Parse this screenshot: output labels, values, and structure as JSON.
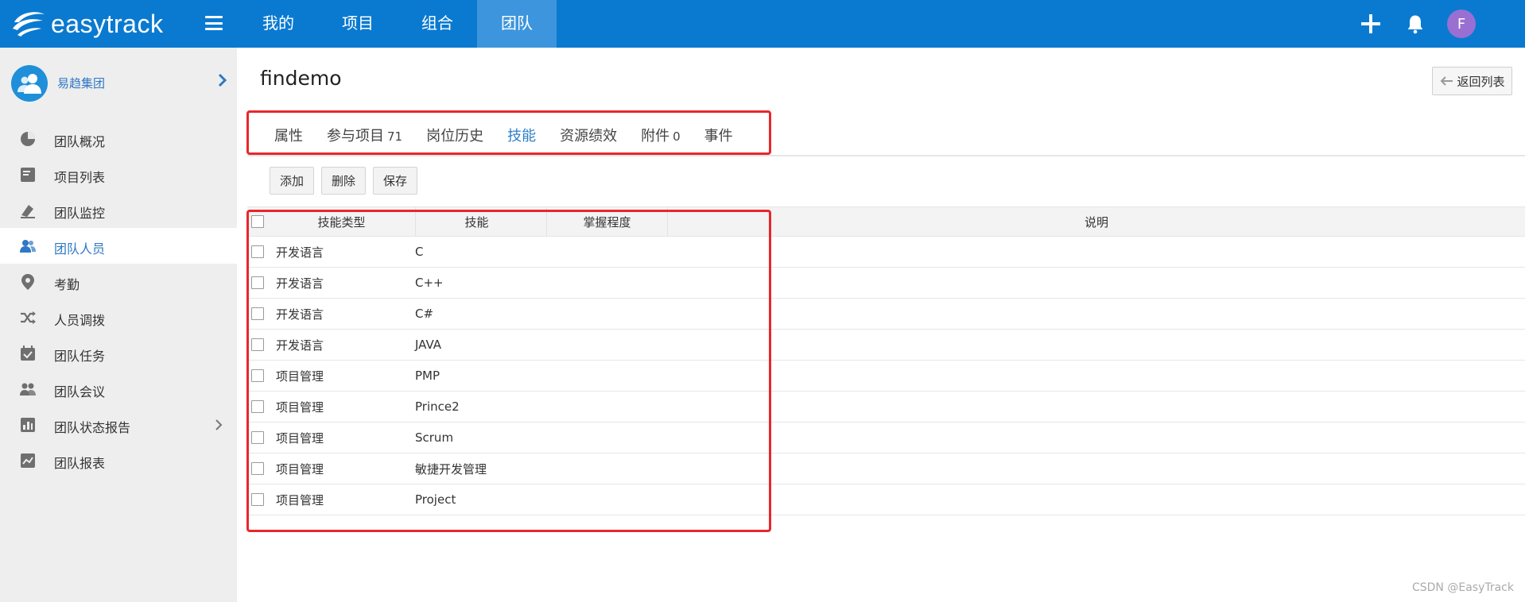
{
  "brand": {
    "name": "easytrack"
  },
  "topnav": {
    "items": [
      {
        "label": "我的",
        "active": false
      },
      {
        "label": "项目",
        "active": false
      },
      {
        "label": "组合",
        "active": false
      },
      {
        "label": "团队",
        "active": true
      }
    ],
    "user_initial": "F"
  },
  "sidebar": {
    "team_name": "易趋集团",
    "items": [
      {
        "label": "团队概况",
        "icon": "pie-chart-icon"
      },
      {
        "label": "项目列表",
        "icon": "inbox-icon"
      },
      {
        "label": "团队监控",
        "icon": "monitor-icon"
      },
      {
        "label": "团队人员",
        "icon": "people-icon",
        "active": true
      },
      {
        "label": "考勤",
        "icon": "location-icon"
      },
      {
        "label": "人员调拨",
        "icon": "shuffle-icon"
      },
      {
        "label": "团队任务",
        "icon": "calendar-check-icon"
      },
      {
        "label": "团队会议",
        "icon": "meeting-icon"
      },
      {
        "label": "团队状态报告",
        "icon": "bar-report-icon",
        "has_submenu": true
      },
      {
        "label": "团队报表",
        "icon": "chart-report-icon"
      }
    ]
  },
  "page": {
    "title": "findemo",
    "back_label": "返回列表"
  },
  "tabs": [
    {
      "label": "属性",
      "count": ""
    },
    {
      "label": "参与项目",
      "count": "71"
    },
    {
      "label": "岗位历史",
      "count": ""
    },
    {
      "label": "技能",
      "count": "",
      "active": true
    },
    {
      "label": "资源绩效",
      "count": ""
    },
    {
      "label": "附件",
      "count": "0"
    },
    {
      "label": "事件",
      "count": ""
    }
  ],
  "toolbar": {
    "add_label": "添加",
    "delete_label": "删除",
    "save_label": "保存"
  },
  "grid": {
    "columns": {
      "type": "技能类型",
      "skill": "技能",
      "level": "掌握程度",
      "desc": "说明"
    },
    "rows": [
      {
        "type": "开发语言",
        "skill": "C",
        "level": "",
        "desc": ""
      },
      {
        "type": "开发语言",
        "skill": "C++",
        "level": "",
        "desc": ""
      },
      {
        "type": "开发语言",
        "skill": "C#",
        "level": "",
        "desc": ""
      },
      {
        "type": "开发语言",
        "skill": "JAVA",
        "level": "",
        "desc": ""
      },
      {
        "type": "项目管理",
        "skill": "PMP",
        "level": "",
        "desc": ""
      },
      {
        "type": "项目管理",
        "skill": "Prince2",
        "level": "",
        "desc": ""
      },
      {
        "type": "项目管理",
        "skill": "Scrum",
        "level": "",
        "desc": ""
      },
      {
        "type": "项目管理",
        "skill": "敏捷开发管理",
        "level": "",
        "desc": ""
      },
      {
        "type": "项目管理",
        "skill": "Project",
        "level": "",
        "desc": ""
      }
    ]
  },
  "colors": {
    "topbar": "#0a7ad1",
    "active_nav": "#3d96dd",
    "accent": "#2f80c8",
    "highlight": "#e8272b",
    "avatar": "#9a6fd2"
  },
  "watermark": "CSDN @EasyTrack"
}
